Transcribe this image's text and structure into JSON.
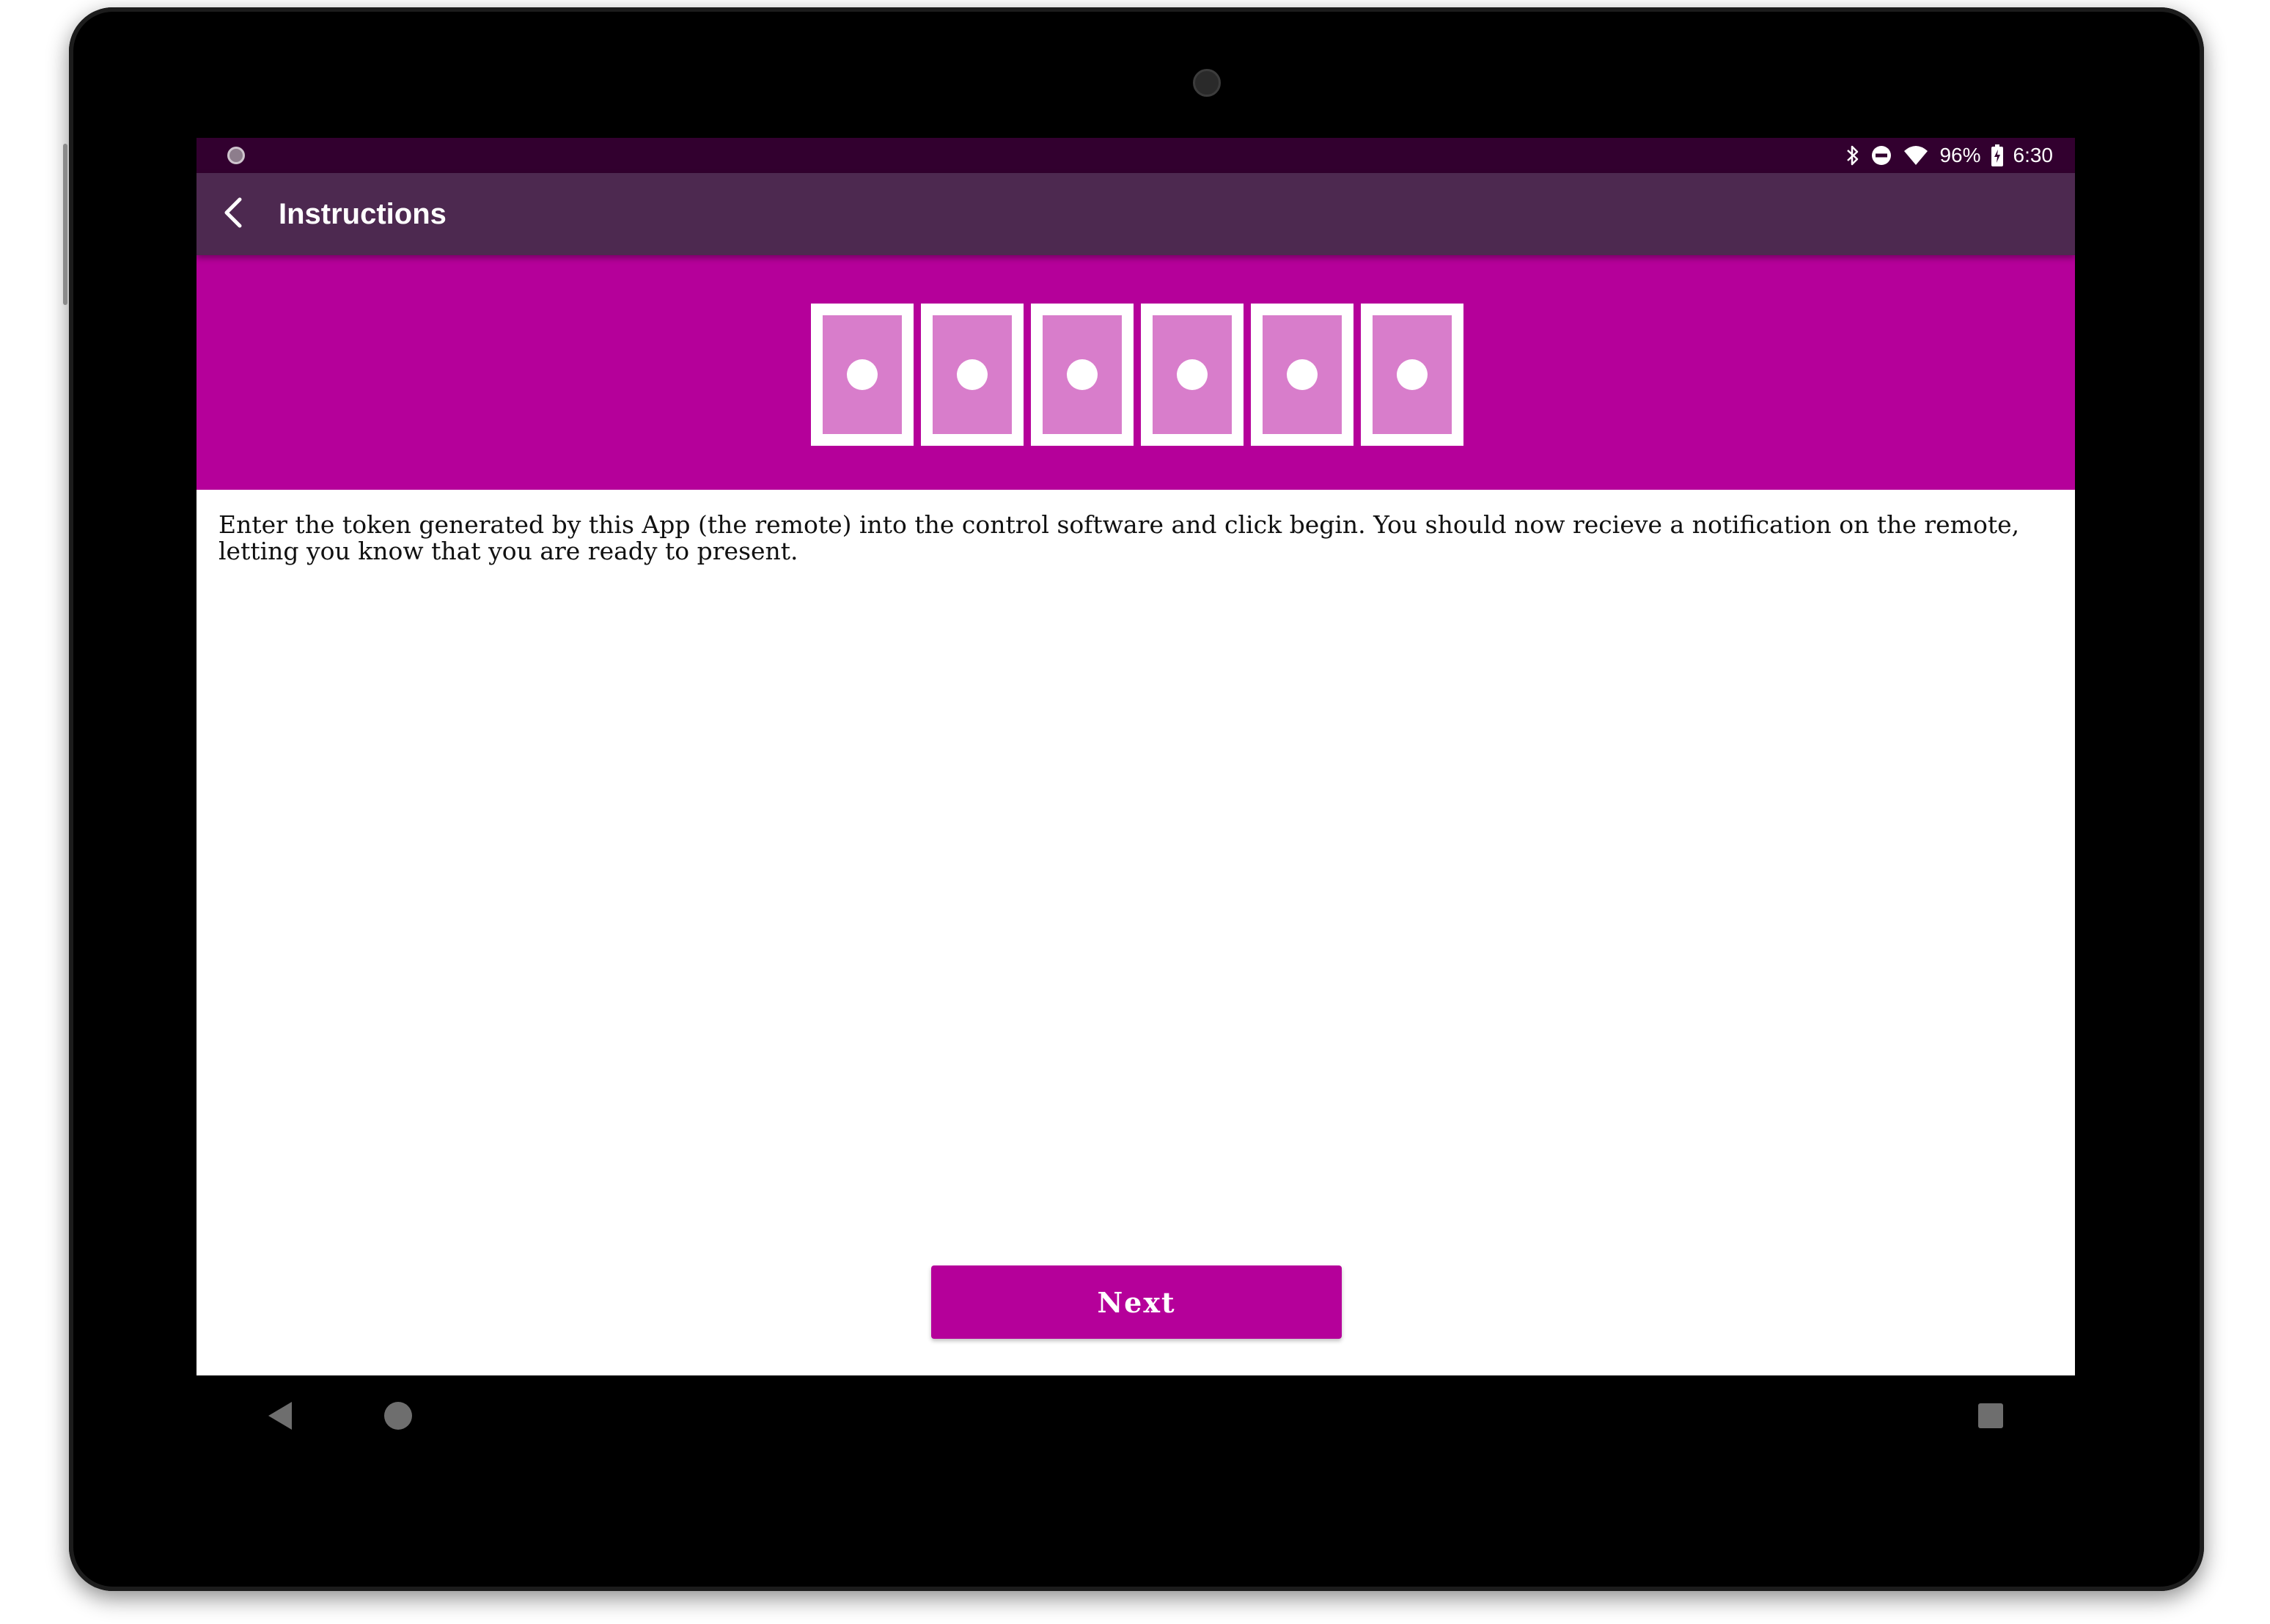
{
  "status_bar": {
    "battery": "96%",
    "time": "6:30",
    "icons": [
      "notification-dot-icon",
      "bluetooth-icon",
      "do-not-disturb-icon",
      "wifi-icon",
      "battery-charging-icon"
    ]
  },
  "app_bar": {
    "title": "Instructions",
    "back_icon": "arrow-back-icon"
  },
  "banner": {
    "token_slots": 6,
    "token_slot_icon": "masked-digit-icon"
  },
  "content": {
    "instructions": "Enter the token generated by this App (the remote) into the control software and click begin. You should now recieve a notification on the remote, letting you know that you are ready to present."
  },
  "actions": {
    "next_label": "Next"
  },
  "nav_bar": {
    "icons": [
      "nav-back-icon",
      "nav-home-icon",
      "nav-recents-icon"
    ]
  },
  "colors": {
    "status_bar": "#32002f",
    "app_bar": "#4d2950",
    "accent": "#b5009a",
    "token_fill": "#d87dcb"
  }
}
